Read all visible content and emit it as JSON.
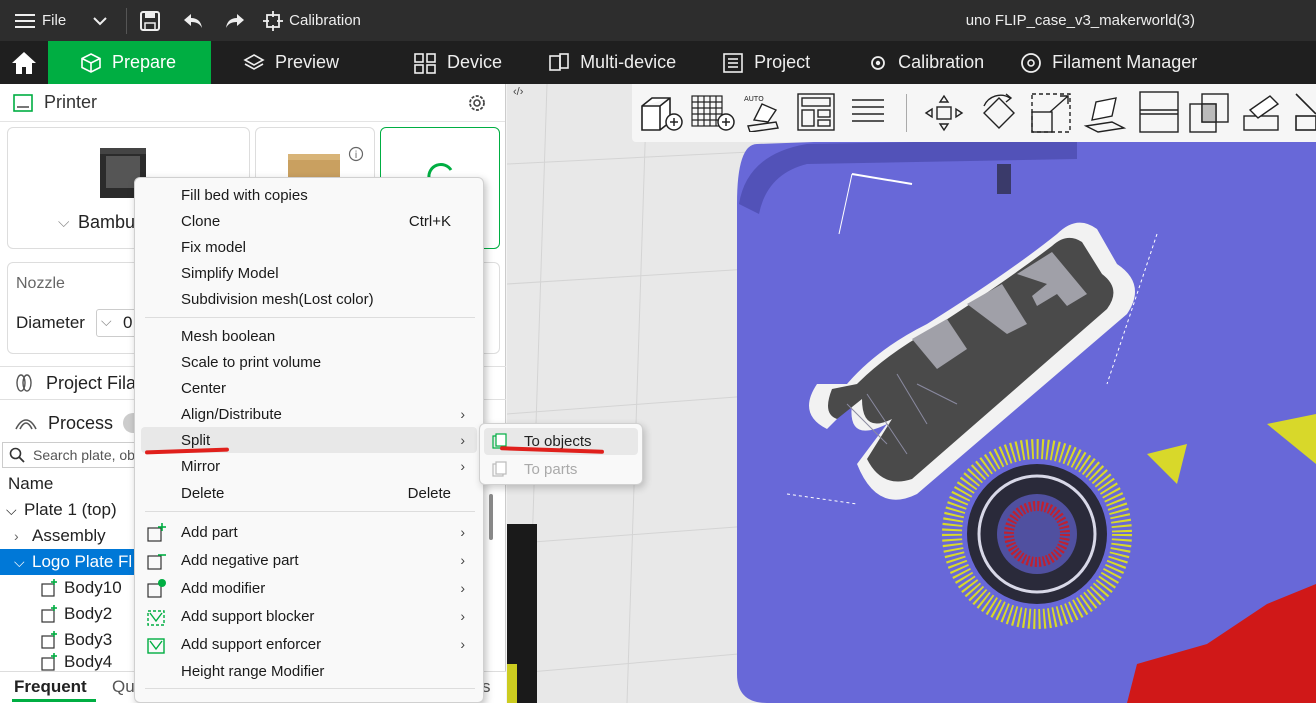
{
  "titlebar": {
    "file_label": "File",
    "calibration_label": "Calibration",
    "window_title": "uno FLIP_case_v3_makerworld(3)"
  },
  "nav": {
    "tabs": [
      {
        "label": "Prepare",
        "active": true
      },
      {
        "label": "Preview"
      },
      {
        "label": "Device"
      },
      {
        "label": "Multi-device"
      },
      {
        "label": "Project"
      },
      {
        "label": "Calibration"
      },
      {
        "label": "Filament Manager"
      }
    ]
  },
  "left": {
    "printer_title": "Printer",
    "printer_name": "Bambu",
    "nozzle_label": "Nozzle",
    "diameter_label": "Diameter",
    "diameter_value": "0",
    "project_filament": "Project Fila",
    "process_label": "Process",
    "search_placeholder": "Search plate, ob",
    "tree_header": "Name",
    "tree": [
      {
        "label": "Plate 1 (top)"
      },
      {
        "label": "Assembly"
      },
      {
        "label": "Logo Plate Fl"
      },
      {
        "label": "Body10"
      },
      {
        "label": "Body2"
      },
      {
        "label": "Body3"
      },
      {
        "label": "Body4"
      }
    ],
    "bottom_tab_frequent": "Frequent",
    "bottom_tab_qu": "Qu",
    "bottom_tab_s": "s"
  },
  "context_menu": {
    "items": [
      {
        "label": "Fill bed with copies"
      },
      {
        "label": "Clone",
        "shortcut": "Ctrl+K"
      },
      {
        "label": "Fix model"
      },
      {
        "label": "Simplify Model"
      },
      {
        "label": "Subdivision mesh(Lost color)"
      },
      {
        "label": "Mesh boolean"
      },
      {
        "label": "Scale to print volume"
      },
      {
        "label": "Center"
      },
      {
        "label": "Align/Distribute"
      },
      {
        "label": "Split"
      },
      {
        "label": "Mirror"
      },
      {
        "label": "Delete",
        "shortcut": "Delete"
      },
      {
        "label": "Add part"
      },
      {
        "label": "Add negative part"
      },
      {
        "label": "Add modifier"
      },
      {
        "label": "Add support blocker"
      },
      {
        "label": "Add support enforcer"
      },
      {
        "label": "Height range Modifier"
      }
    ]
  },
  "submenu": {
    "items": [
      {
        "label": "To objects",
        "enabled": true
      },
      {
        "label": "To parts",
        "enabled": false
      }
    ]
  },
  "colors": {
    "accent": "#00ae42",
    "selection": "#0078d7",
    "plate_blue": "#6464d8",
    "annotation_red": "#e0201c"
  }
}
